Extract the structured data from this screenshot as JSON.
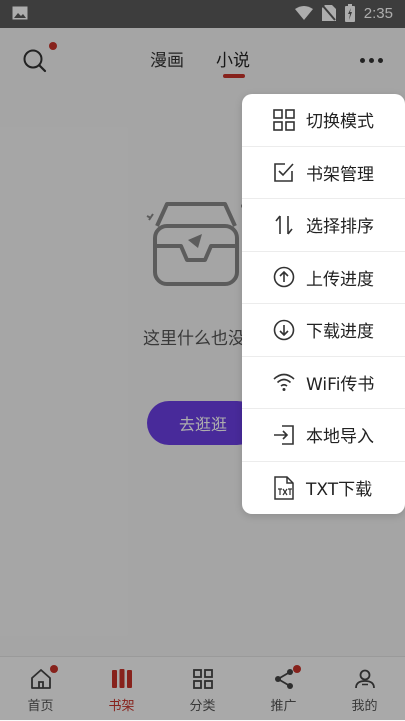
{
  "status_bar": {
    "time": "2:35"
  },
  "header": {
    "tabs": [
      {
        "label": "漫画"
      },
      {
        "label": "小说"
      }
    ],
    "active_tab": 1
  },
  "empty_state": {
    "message": "这里什么也没有",
    "action_label": "去逛逛"
  },
  "bottom_nav": {
    "items": [
      {
        "label": "首页",
        "icon": "home-icon",
        "badge": true
      },
      {
        "label": "书架",
        "icon": "bookshelf-icon",
        "active": true
      },
      {
        "label": "分类",
        "icon": "grid-icon"
      },
      {
        "label": "推广",
        "icon": "share-icon",
        "badge": true
      },
      {
        "label": "我的",
        "icon": "user-icon"
      }
    ]
  },
  "menu": {
    "items": [
      {
        "label": "切换模式",
        "icon": "grid-icon"
      },
      {
        "label": "书架管理",
        "icon": "checkbox-edit-icon"
      },
      {
        "label": "选择排序",
        "icon": "sort-icon"
      },
      {
        "label": "上传进度",
        "icon": "upload-circle-icon"
      },
      {
        "label": "下载进度",
        "icon": "download-circle-icon"
      },
      {
        "label": "WiFi传书",
        "icon": "wifi-icon"
      },
      {
        "label": "本地导入",
        "icon": "import-icon"
      },
      {
        "label": "TXT下载",
        "icon": "txt-file-icon"
      }
    ]
  },
  "colors": {
    "accent": "#c8332a",
    "button": "#6b3fe4"
  }
}
